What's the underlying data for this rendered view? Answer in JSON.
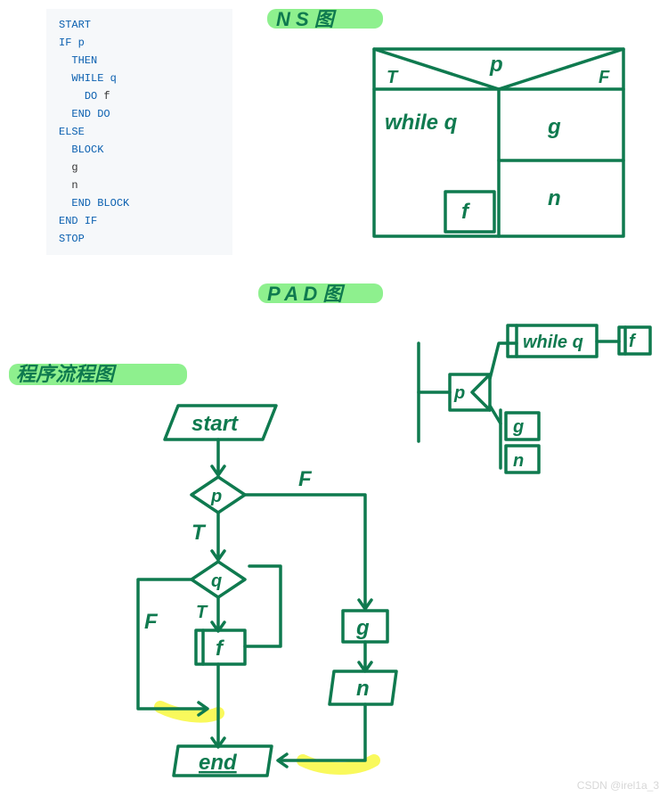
{
  "code": {
    "lines": [
      {
        "text": "START",
        "cls": "kw",
        "indent": 0
      },
      {
        "text": "IF p",
        "cls": "kw",
        "indent": 0
      },
      {
        "text": "THEN",
        "cls": "kw",
        "indent": 1
      },
      {
        "text": "WHILE q",
        "cls": "kw",
        "indent": 1
      },
      {
        "text_pre": "DO ",
        "text_var": "f",
        "cls": "kw",
        "indent": 2
      },
      {
        "text": "END DO",
        "cls": "kw",
        "indent": 1
      },
      {
        "text": "ELSE",
        "cls": "kw",
        "indent": 0
      },
      {
        "text": "BLOCK",
        "cls": "kw",
        "indent": 1
      },
      {
        "text_var": "g",
        "cls": "var",
        "indent": 1
      },
      {
        "text_var": "n",
        "cls": "var",
        "indent": 1
      },
      {
        "text": "END BLOCK",
        "cls": "kw",
        "indent": 1
      },
      {
        "text": "END IF",
        "cls": "kw",
        "indent": 0
      },
      {
        "text": "STOP",
        "cls": "kw",
        "indent": 0
      }
    ]
  },
  "labels": {
    "ns": "N S 图",
    "pad": "P A D 图",
    "flow": "程序流程图"
  },
  "ns_diagram": {
    "p": "p",
    "T": "T",
    "F": "F",
    "while_q": "while q",
    "f": "f",
    "g": "g",
    "n": "n"
  },
  "pad_diagram": {
    "p": "p",
    "while_q": "while q",
    "f": "f",
    "g": "g",
    "n": "n"
  },
  "flowchart": {
    "start": "start",
    "p": "p",
    "q": "q",
    "f": "f",
    "g": "g",
    "n": "n",
    "end": "end",
    "T": "T",
    "F": "F"
  },
  "watermark": "CSDN @irel1a_3",
  "chart_data": {
    "type": "diagram",
    "description": "Three representations of the same algorithm: pseudocode, N-S (Nassi-Shneiderman) diagram, PAD diagram, and traditional flowchart.",
    "algorithm": {
      "structure": "IF p THEN (WHILE q DO f) ELSE (BLOCK g; n)",
      "condition": "p",
      "then_branch": {
        "loop_condition": "q",
        "loop_body": "f"
      },
      "else_branch": {
        "sequence": [
          "g",
          "n"
        ]
      }
    }
  }
}
